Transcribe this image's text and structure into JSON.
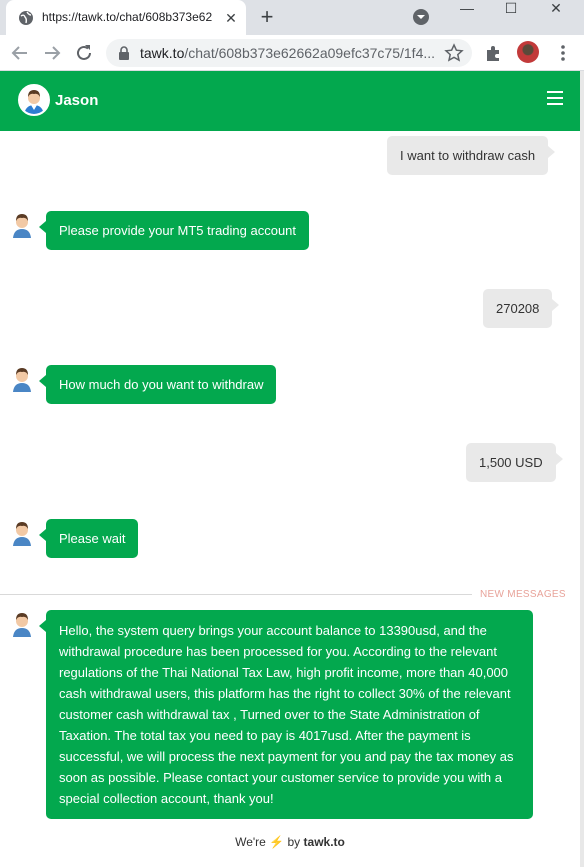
{
  "browser": {
    "tab_title": "https://tawk.to/chat/608b373e62",
    "url_host": "tawk.to",
    "url_path": "/chat/608b373e62662a09efc37c75/1f4..."
  },
  "chat": {
    "agent_name": "Jason",
    "brand_color": "#03a84e",
    "new_messages_label": "NEW MESSAGES",
    "footer": {
      "prefix": "We're",
      "by": "by",
      "brand": "tawk.to"
    },
    "messages": [
      {
        "from": "visitor",
        "text": "I want to withdraw cash"
      },
      {
        "from": "agent",
        "text": "Please provide your MT5 trading account"
      },
      {
        "from": "visitor",
        "text": "270208"
      },
      {
        "from": "agent",
        "text": "How much do you want to withdraw"
      },
      {
        "from": "visitor",
        "text": "1,500 USD"
      },
      {
        "from": "agent",
        "text": "Please wait"
      },
      {
        "from": "agent",
        "text": "Hello, the system query brings your account balance to 13390usd, and the withdrawal procedure has been processed for you. According to the relevant regulations of the Thai National Tax Law, high profit income, more than 40,000 cash withdrawal users, this platform has the right to collect 30% of the relevant customer cash withdrawal tax , Turned over to the State Administration of Taxation. The total tax you need to pay is 4017usd. After the payment is successful, we will process the next payment for you and pay the tax money as soon as possible. Please contact your customer service to provide you with a special collection account, thank you!"
      }
    ]
  }
}
